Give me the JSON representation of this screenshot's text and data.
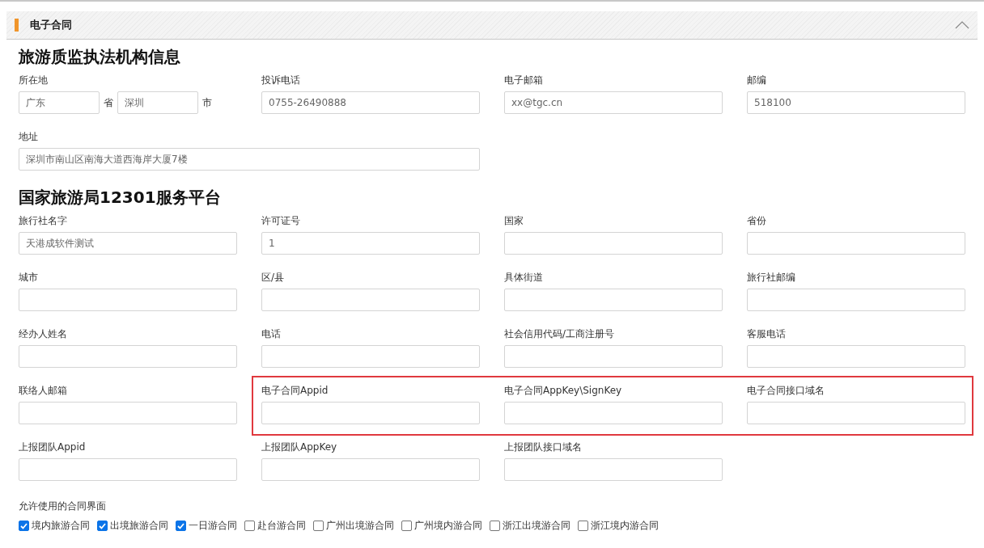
{
  "panel": {
    "title": "电子合同",
    "expanded": true
  },
  "sections": [
    {
      "heading": "旅游质监执法机构信息",
      "rows": [
        {
          "fields": [
            {
              "kind": "location",
              "label": "所在地",
              "parts": [
                {
                  "value": "广东",
                  "suffix": "省"
                },
                {
                  "value": "深圳",
                  "suffix": "市"
                }
              ]
            },
            {
              "kind": "text",
              "label": "投诉电话",
              "value": "0755-26490888"
            },
            {
              "kind": "text",
              "label": "电子邮箱",
              "value": "xx@tgc.cn"
            },
            {
              "kind": "text",
              "label": "邮编",
              "value": "518100"
            }
          ]
        },
        {
          "fields": [
            {
              "kind": "wide",
              "label": "地址",
              "value": "深圳市南山区南海大道西海岸大厦7楼"
            }
          ]
        }
      ]
    },
    {
      "heading": "国家旅游局12301服务平台",
      "rows": [
        {
          "fields": [
            {
              "kind": "text",
              "label": "旅行社名字",
              "value": "天港成软件测试"
            },
            {
              "kind": "text",
              "label": "许可证号",
              "value": "1"
            },
            {
              "kind": "text",
              "label": "国家"
            },
            {
              "kind": "text",
              "label": "省份"
            }
          ]
        },
        {
          "fields": [
            {
              "kind": "text",
              "label": "城市"
            },
            {
              "kind": "text",
              "label": "区/县"
            },
            {
              "kind": "text",
              "label": "具体街道"
            },
            {
              "kind": "text",
              "label": "旅行社邮编"
            }
          ]
        },
        {
          "fields": [
            {
              "kind": "text",
              "label": "经办人姓名"
            },
            {
              "kind": "text",
              "label": "电话"
            },
            {
              "kind": "text",
              "label": "社会信用代码/工商注册号"
            },
            {
              "kind": "text",
              "label": "客服电话"
            }
          ]
        },
        {
          "fields": [
            {
              "kind": "text",
              "label": "联络人邮箱"
            }
          ],
          "highlighted": [
            {
              "kind": "text",
              "label": "电子合同Appid"
            },
            {
              "kind": "text",
              "label": "电子合同AppKey\\SignKey"
            },
            {
              "kind": "text",
              "label": "电子合同接口域名"
            }
          ]
        },
        {
          "fields": [
            {
              "kind": "text",
              "label": "上报团队Appid"
            },
            {
              "kind": "text",
              "label": "上报团队AppKey"
            },
            {
              "kind": "text",
              "label": "上报团队接口域名"
            }
          ]
        }
      ]
    }
  ],
  "contract_types": {
    "label": "允许使用的合同界面",
    "options": [
      {
        "label": "境内旅游合同",
        "checked": true
      },
      {
        "label": "出境旅游合同",
        "checked": true
      },
      {
        "label": "一日游合同",
        "checked": true
      },
      {
        "label": "赴台游合同",
        "checked": false
      },
      {
        "label": "广州出境游合同",
        "checked": false
      },
      {
        "label": "广州境内游合同",
        "checked": false
      },
      {
        "label": "浙江出境游合同",
        "checked": false
      },
      {
        "label": "浙江境内游合同",
        "checked": false
      }
    ]
  }
}
